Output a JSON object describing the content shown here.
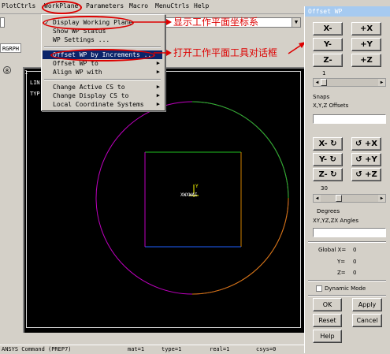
{
  "menubar": {
    "items": [
      "PlotCtrls",
      "WorkPlane",
      "Parameters",
      "Macro",
      "MenuCtrls",
      "Help"
    ]
  },
  "dropdown": {
    "display_wp": "Display Working Plane",
    "show_wp_status": "Show WP Status",
    "wp_settings": "WP Settings ...",
    "offset_wp_increments": "Offset WP by Increments ...",
    "offset_wp_to": "Offset WP to",
    "align_wp_with": "Align WP with",
    "change_active_cs": "Change Active CS to",
    "change_display_cs": "Change Display CS to",
    "local_cs": "Local Coordinate Systems"
  },
  "annotations": {
    "display_note": "显示工作平面坐标系",
    "offset_note": "打开工作平面工具对话框"
  },
  "left": {
    "rgrph": "RGRPH",
    "num_badge": "8"
  },
  "graphics": {
    "window_number": "1",
    "line1": "LIN",
    "line2": "TYP",
    "wp_label": "XWXWAI",
    "wp_y": "Y",
    "colors": {
      "circle": "#c000c0",
      "square": "#c8c800",
      "triad": "#ffff00"
    }
  },
  "statusbar": {
    "command": "ANSYS Command (PREP7)",
    "mat": "mat=1",
    "type": "type=1",
    "real": "real=1",
    "csys": "csys=0"
  },
  "dialog": {
    "title": "Offset WP",
    "trans_buttons": [
      "X-",
      "+X",
      "Y-",
      "+Y",
      "Z-",
      "+Z"
    ],
    "trans_increment": "1",
    "snaps_label": "Snaps",
    "xyz_offsets_label": "X,Y,Z Offsets",
    "rot_buttons": [
      "X- ↻",
      "↺ +X",
      "Y- ↻",
      "↺ +Y",
      "Z- ↻",
      "↺ +Z"
    ],
    "rot_increment": "30",
    "degrees_label": "Degrees",
    "angles_label": "XY,YZ,ZX Angles",
    "global_x_label": "Global X=",
    "global_x": "0",
    "global_y_label": "Y=",
    "global_y": "0",
    "global_z_label": "Z=",
    "global_z": "0",
    "dynamic_mode": "Dynamic Mode",
    "ok": "OK",
    "apply": "Apply",
    "reset": "Reset",
    "cancel": "Cancel",
    "help": "Help"
  }
}
